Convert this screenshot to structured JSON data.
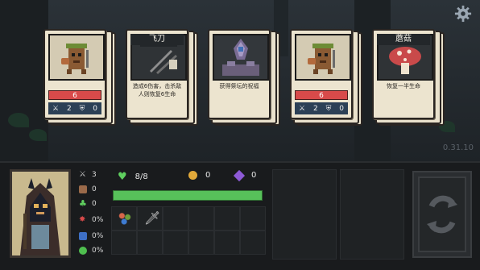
{
  "hud": {
    "version": "0.31.10",
    "settings_icon": "gear-icon"
  },
  "cards": [
    {
      "type": "enemy",
      "art": "tree-stump-creature",
      "hp": "6",
      "attack": "2",
      "defense": "0"
    },
    {
      "type": "item",
      "title": "飞刀",
      "art": "flying-knives",
      "desc_line1": "造成6伤害，击杀敌",
      "desc_line2": "人则恢复6生命"
    },
    {
      "type": "item",
      "title": "",
      "art": "purple-crystal-altar",
      "desc_line1": "获得祭坛的祝福",
      "desc_line2": ""
    },
    {
      "type": "enemy",
      "art": "tree-stump-creature",
      "hp": "6",
      "attack": "2",
      "defense": "0"
    },
    {
      "type": "item",
      "title": "蘑菇",
      "art": "red-mushroom",
      "desc_line1": "恢复一半生命",
      "desc_line2": ""
    }
  ],
  "player": {
    "portrait": "hooded-cat-wanderer",
    "attack": "3",
    "defense": "0",
    "luck": "0",
    "crit": "0%",
    "dodge": "0%",
    "heal": "0%",
    "hp_text": "8/8",
    "hp_fraction": 1.0,
    "gold": "0",
    "gems": "0"
  },
  "inventory": {
    "items": [
      "berry-cluster-icon",
      "dagger-icon"
    ]
  },
  "colors": {
    "hp_green": "#57c15a",
    "enemy_hp_red": "#d84a4a",
    "card_paper": "#ece4cf"
  }
}
